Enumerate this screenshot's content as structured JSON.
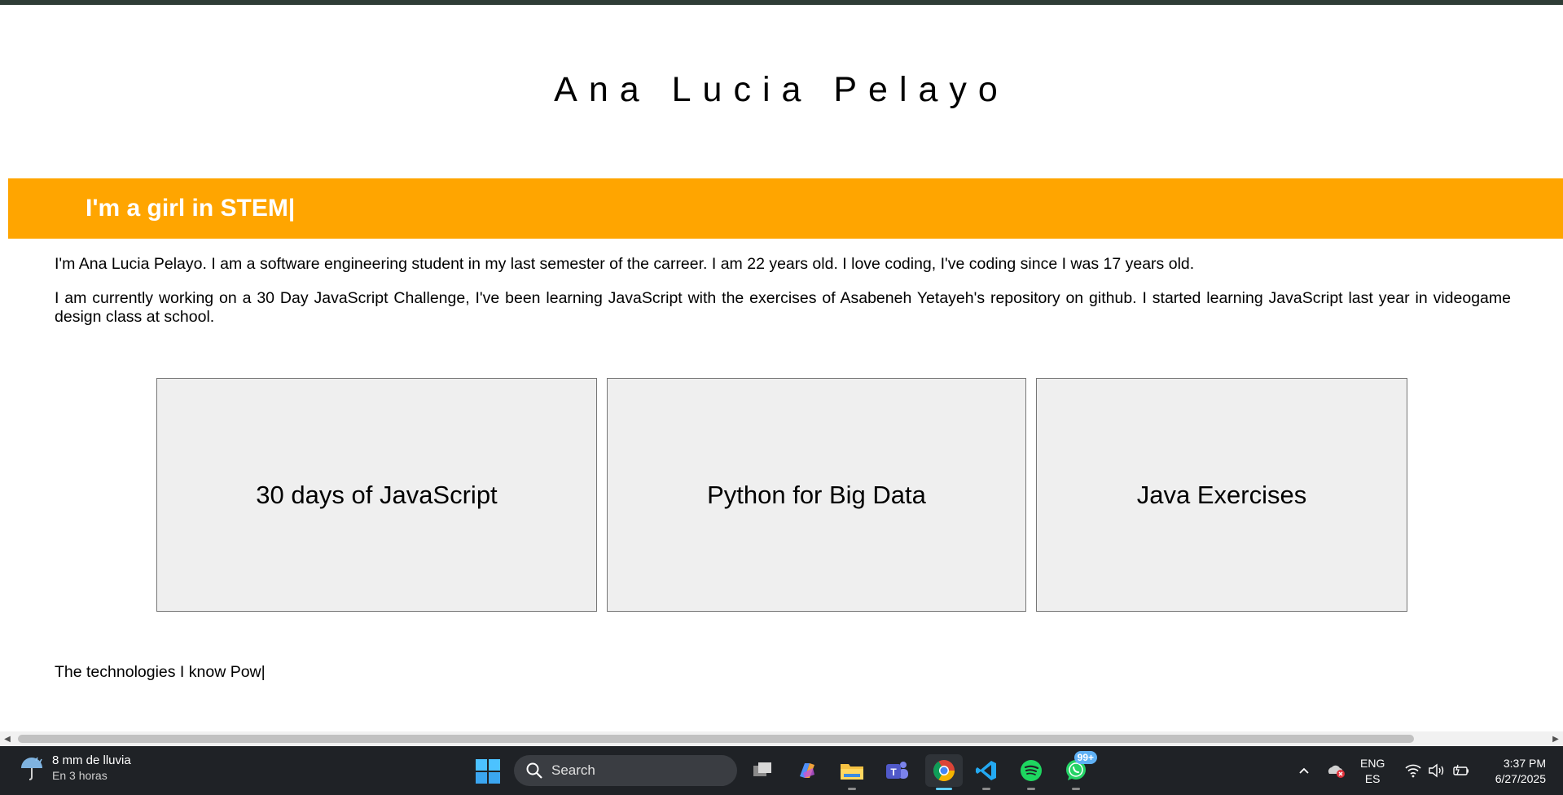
{
  "page": {
    "name": "Ana Lucia Pelayo",
    "banner_text": "I'm a girl in STEM|",
    "intro_paragraph": "I'm Ana Lucia Pelayo. I am a software engineering student in my last semester of the carreer. I am 22 years old. I love coding, I've coding since I was 17 years old.",
    "challenge_paragraph": "I am currently working on a 30 Day JavaScript Challenge, I've been learning JavaScript with the exercises of Asabeneh Yetayeh's repository on github. I started learning JavaScript last year in videogame design class at school.",
    "cards": [
      {
        "label": "30 days of JavaScript"
      },
      {
        "label": "Python for Big Data"
      },
      {
        "label": "Java Exercises"
      }
    ],
    "technologies_text": "The technologies I know Pow|",
    "colors": {
      "banner": "#ffa500",
      "card_bg": "#efefef"
    }
  },
  "taskbar": {
    "weather_main": "8 mm de lluvia",
    "weather_sub": "En 3 horas",
    "search_label": "Search",
    "whatsapp_badge": "99+",
    "lang_top": "ENG",
    "lang_bottom": "ES",
    "time": "3:37 PM",
    "date": "6/27/2025",
    "apps": [
      "task-view",
      "copilot",
      "file-explorer",
      "teams",
      "chrome",
      "vscode",
      "spotify",
      "whatsapp"
    ]
  }
}
